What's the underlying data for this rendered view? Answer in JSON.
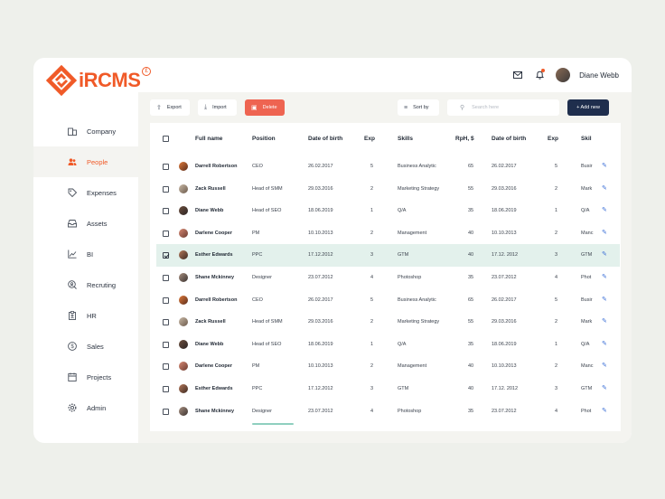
{
  "app": {
    "logo_text": "iRCMS",
    "logo_badge": "£"
  },
  "header": {
    "user_name": "Diane Webb"
  },
  "sidebar": {
    "items": [
      {
        "label": "Company",
        "icon": "building-icon"
      },
      {
        "label": "People",
        "icon": "people-icon",
        "active": true
      },
      {
        "label": "Expenses",
        "icon": "tag-icon"
      },
      {
        "label": "Assets",
        "icon": "inbox-icon"
      },
      {
        "label": "BI",
        "icon": "chart-icon"
      },
      {
        "label": "Recruting",
        "icon": "search-person-icon"
      },
      {
        "label": "HR",
        "icon": "clipboard-icon"
      },
      {
        "label": "Sales",
        "icon": "dollar-icon"
      },
      {
        "label": "Projects",
        "icon": "calendar-icon"
      },
      {
        "label": "Admin",
        "icon": "gear-icon"
      }
    ]
  },
  "toolbar": {
    "export_label": "Export",
    "import_label": "Import",
    "delete_label": "Delete",
    "sort_label": "Sort by",
    "search_placeholder": "Search here",
    "add_label": "+ Add new"
  },
  "table": {
    "headers": [
      "Full name",
      "Position",
      "Date of birth",
      "Exp",
      "Skills",
      "RpH, $",
      "Date of birth",
      "Exp",
      "Skil"
    ],
    "rows": [
      {
        "name": "Darrell Robertson",
        "position": "CEO",
        "dob": "26.02.2017",
        "exp": "5",
        "skills": "Business Analytic",
        "rph": "65",
        "dob2": "26.02.2017",
        "exp2": "5",
        "skill2": "Busir",
        "checked": false
      },
      {
        "name": "Zack Russell",
        "position": "Head of SMM",
        "dob": "29.03.2016",
        "exp": "2",
        "skills": "Marketing Strategy",
        "rph": "55",
        "dob2": "29.03.2016",
        "exp2": "2",
        "skill2": "Mark",
        "checked": false
      },
      {
        "name": "Diane Webb",
        "position": "Head of SEO",
        "dob": "18.06.2019",
        "exp": "1",
        "skills": "Q/A",
        "rph": "35",
        "dob2": "18.06.2019",
        "exp2": "1",
        "skill2": "Q/A",
        "checked": false
      },
      {
        "name": "Darlene Cooper",
        "position": "PM",
        "dob": "10.10.2013",
        "exp": "2",
        "skills": "Management",
        "rph": "40",
        "dob2": "10.10.2013",
        "exp2": "2",
        "skill2": "Manc",
        "checked": false
      },
      {
        "name": "Esther Edwards",
        "position": "PPC",
        "dob": "17.12.2012",
        "exp": "3",
        "skills": "GTM",
        "rph": "40",
        "dob2": "17.12. 2012",
        "exp2": "3",
        "skill2": "GTM",
        "checked": true
      },
      {
        "name": "Shane Mckinney",
        "position": "Designer",
        "dob": "23.07.2012",
        "exp": "4",
        "skills": "Photoshop",
        "rph": "35",
        "dob2": "23.07.2012",
        "exp2": "4",
        "skill2": "Phot",
        "checked": false
      },
      {
        "name": "Darrell Robertson",
        "position": "CEO",
        "dob": "26.02.2017",
        "exp": "5",
        "skills": "Business Analytic",
        "rph": "65",
        "dob2": "26.02.2017",
        "exp2": "5",
        "skill2": "Busir",
        "checked": false
      },
      {
        "name": "Zack Russell",
        "position": "Head of SMM",
        "dob": "29.03.2016",
        "exp": "2",
        "skills": "Marketing Strategy",
        "rph": "55",
        "dob2": "29.03.2016",
        "exp2": "2",
        "skill2": "Mark",
        "checked": false
      },
      {
        "name": "Diane Webb",
        "position": "Head of SEO",
        "dob": "18.06.2019",
        "exp": "1",
        "skills": "Q/A",
        "rph": "35",
        "dob2": "18.06.2019",
        "exp2": "1",
        "skill2": "Q/A",
        "checked": false
      },
      {
        "name": "Darlene Cooper",
        "position": "PM",
        "dob": "10.10.2013",
        "exp": "2",
        "skills": "Management",
        "rph": "40",
        "dob2": "10.10.2013",
        "exp2": "2",
        "skill2": "Manc",
        "checked": false
      },
      {
        "name": "Esther Edwards",
        "position": "PPC",
        "dob": "17.12.2012",
        "exp": "3",
        "skills": "GTM",
        "rph": "40",
        "dob2": "17.12. 2012",
        "exp2": "3",
        "skill2": "GTM",
        "checked": false
      },
      {
        "name": "Shane Mckinney",
        "position": "Designer",
        "dob": "23.07.2012",
        "exp": "4",
        "skills": "Photoshop",
        "rph": "35",
        "dob2": "23.07.2012",
        "exp2": "4",
        "skill2": "Phot",
        "checked": false
      }
    ]
  },
  "colors": {
    "accent": "#f05a28",
    "navy": "#1f2e4d",
    "delete": "#ee6451",
    "selected_row": "#e3f1ec",
    "edit": "#3b6fd6"
  }
}
